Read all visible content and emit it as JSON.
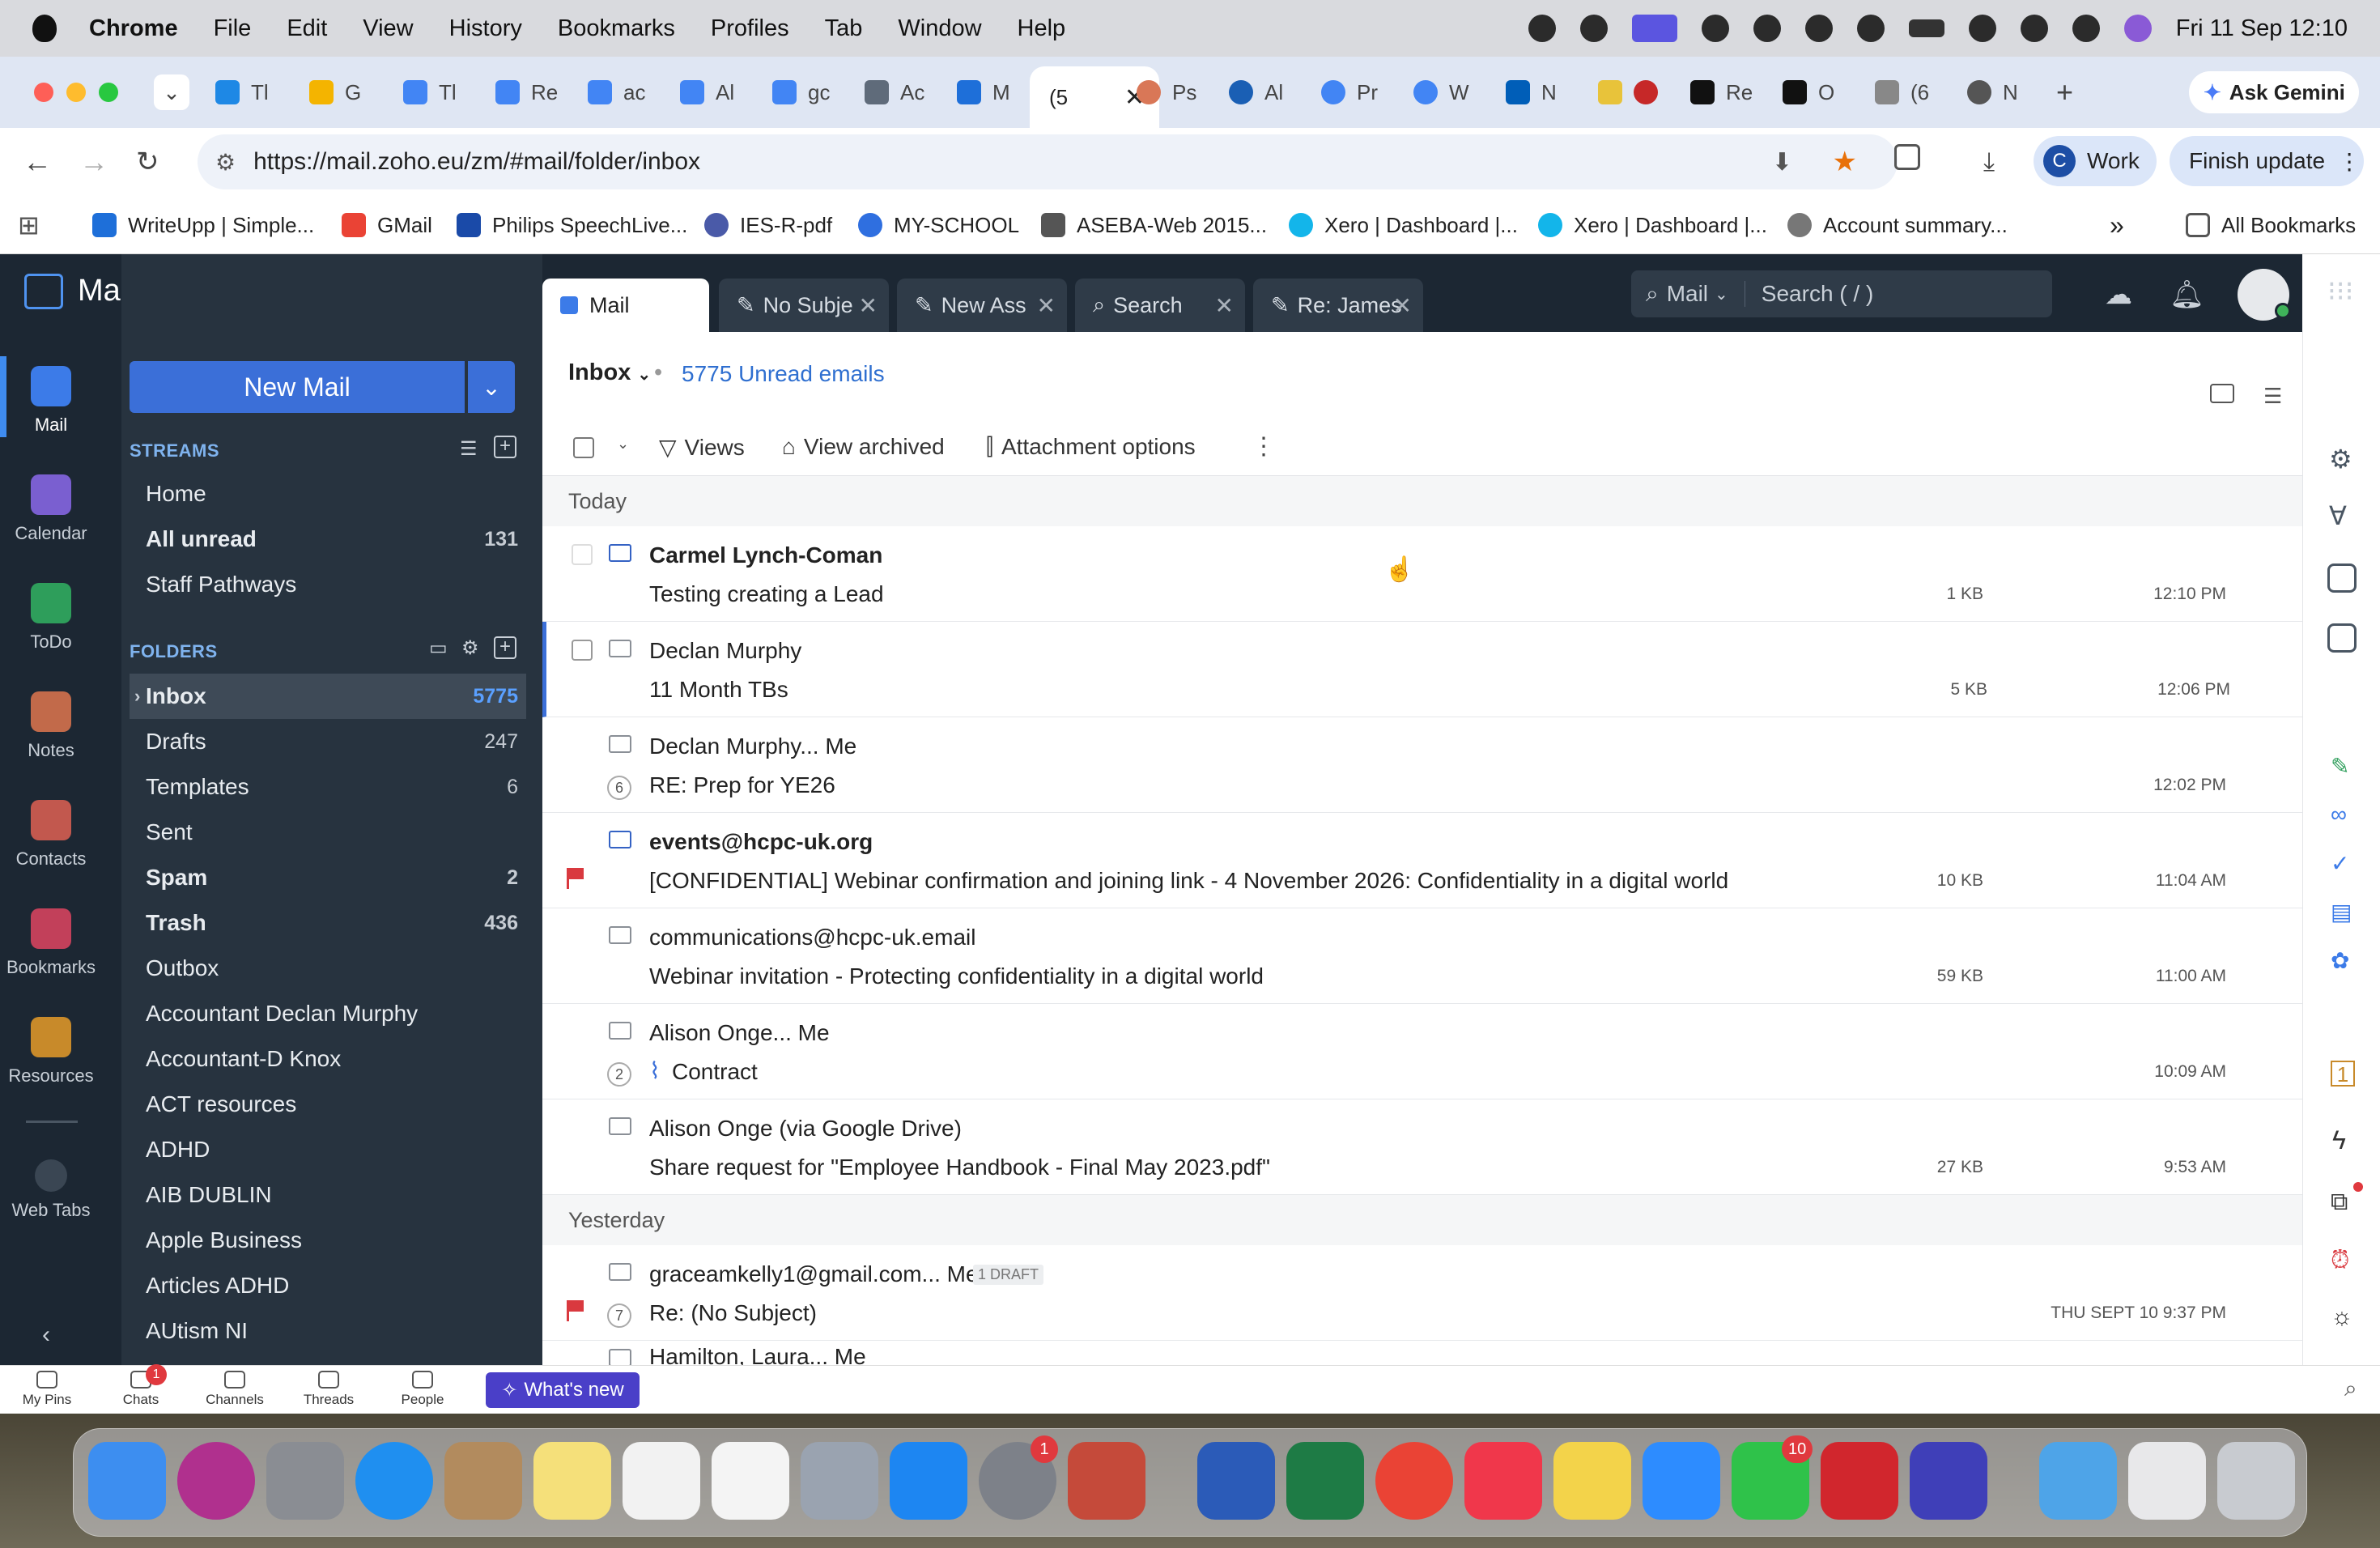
{
  "menubar": {
    "app": "Chrome",
    "items": [
      "File",
      "Edit",
      "View",
      "History",
      "Bookmarks",
      "Profiles",
      "Tab",
      "Window",
      "Help"
    ],
    "clock": "Fri 11 Sep  12:10"
  },
  "browser": {
    "tabs": [
      "Tl",
      "G",
      "Tl",
      "Re",
      "ac",
      "Al",
      "gc",
      "Ac",
      "M",
      "(5",
      "Ps",
      "Al",
      "Pr",
      "W",
      "N",
      "",
      "Re",
      "O",
      "(6",
      "N"
    ],
    "ask_gemini": "Ask Gemini",
    "url": "https://mail.zoho.eu/zm/#mail/folder/inbox",
    "profile": "Work",
    "profile_initial": "C",
    "finish_update": "Finish update",
    "bookmarks": [
      "WriteUpp | Simple...",
      "GMail",
      "Philips SpeechLive...",
      "IES-R-pdf",
      "MY-SCHOOL",
      "ASEBA-Web 2015...",
      "Xero | Dashboard |...",
      "Xero | Dashboard |...",
      "Account summary..."
    ],
    "all_bookmarks": "All Bookmarks"
  },
  "app": {
    "name": "Mail",
    "rail": [
      "Mail",
      "Calendar",
      "ToDo",
      "Notes",
      "Contacts",
      "Bookmarks",
      "Resources",
      "Web Tabs"
    ],
    "new_mail": "New Mail",
    "streams_title": "STREAMS",
    "streams": [
      {
        "label": "Home",
        "count": ""
      },
      {
        "label": "All unread",
        "count": "131"
      },
      {
        "label": "Staff Pathways",
        "count": ""
      }
    ],
    "folders_title": "FOLDERS",
    "folders": [
      {
        "label": "Inbox",
        "count": "5775"
      },
      {
        "label": "Drafts",
        "count": "247"
      },
      {
        "label": "Templates",
        "count": "6"
      },
      {
        "label": "Sent",
        "count": ""
      },
      {
        "label": "Spam",
        "count": "2"
      },
      {
        "label": "Trash",
        "count": "436"
      },
      {
        "label": "Outbox",
        "count": ""
      },
      {
        "label": "Accountant Declan Murphy",
        "count": ""
      },
      {
        "label": "Accountant-D Knox",
        "count": ""
      },
      {
        "label": "ACT resources",
        "count": ""
      },
      {
        "label": "ADHD",
        "count": ""
      },
      {
        "label": "AIB DUBLIN",
        "count": ""
      },
      {
        "label": "Apple Business",
        "count": ""
      },
      {
        "label": "Articles ADHD",
        "count": ""
      },
      {
        "label": "AUtism NI",
        "count": ""
      }
    ],
    "tabs": [
      "Mail",
      "No Subje",
      "New Ass",
      "Search",
      "Re: James"
    ],
    "search_scope": "Mail",
    "search_placeholder": "Search ( / )",
    "inbox_label": "Inbox",
    "unread_label": "5775 Unread emails",
    "toolbar": {
      "views": "Views",
      "archived": "View archived",
      "attachments": "Attachment options"
    },
    "day_today": "Today",
    "day_yesterday": "Yesterday",
    "emails": [
      {
        "sender": "Carmel Lynch-Coman",
        "subject": "Testing creating a Lead",
        "size": "1 KB",
        "time": "12:10 PM",
        "unread": true,
        "thread": "",
        "flag": false
      },
      {
        "sender": "Declan Murphy",
        "subject": "11 Month TBs",
        "size": "5 KB",
        "time": "12:06 PM",
        "unread": false,
        "thread": "",
        "flag": false
      },
      {
        "sender": "Declan Murphy... Me",
        "subject": "RE: Prep for YE26",
        "size": "",
        "time": "12:02 PM",
        "unread": false,
        "thread": "6",
        "flag": false
      },
      {
        "sender": "events@hcpc-uk.org",
        "subject": "[CONFIDENTIAL] Webinar confirmation and joining link - 4 November 2026: Confidentiality in a digital world",
        "size": "10 KB",
        "time": "11:04 AM",
        "unread": true,
        "thread": "",
        "flag": true
      },
      {
        "sender": "communications@hcpc-uk.email",
        "subject": "Webinar invitation - Protecting confidentiality in a digital world",
        "size": "59 KB",
        "time": "11:00 AM",
        "unread": false,
        "thread": "",
        "flag": false
      },
      {
        "sender": "Alison Onge... Me",
        "subject": "Contract",
        "size": "",
        "time": "10:09 AM",
        "unread": false,
        "thread": "2",
        "flag": false
      },
      {
        "sender": "Alison Onge (via Google Drive)",
        "subject": "Share request for \"Employee Handbook - Final May 2023.pdf\"",
        "size": "27 KB",
        "time": "9:53 AM",
        "unread": false,
        "thread": "",
        "flag": false
      }
    ],
    "yesterday_emails": [
      {
        "sender": "graceamkelly1@gmail.com... Me",
        "draft": "1 DRAFT",
        "subject": "Re: (No Subject)",
        "time": "THU SEPT 10 9:37 PM",
        "thread": "7",
        "flag": true
      },
      {
        "sender": "Hamilton, Laura... Me"
      }
    ],
    "bottom": {
      "items": [
        "My Pins",
        "Chats",
        "Channels",
        "Threads",
        "People"
      ],
      "chats_badge": "1",
      "whats_new": "What's new"
    }
  },
  "dock": {
    "settings_badge": "1",
    "facetime_badge": "10"
  }
}
